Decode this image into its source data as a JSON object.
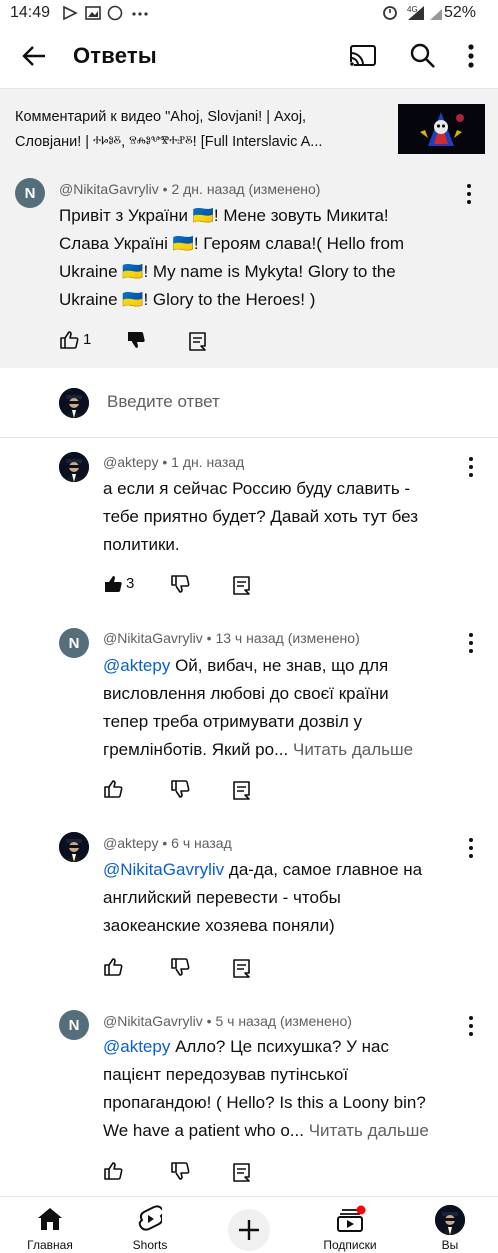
{
  "status_bar": {
    "time": "14:49",
    "battery": "52%",
    "network": "4G"
  },
  "app_bar": {
    "title": "Ответы"
  },
  "video": {
    "title": "Комментарий к видео \"Ahoj, Slovjani! | Ахој,\nСловјани! | ⰰⱈⱁⰻ, ⱄⰾⱁⰲⰺⰰⱀⰻ! [Full Interslavic A..."
  },
  "original_comment": {
    "avatar_letter": "N",
    "meta": "@NikitaGavryliv • 2 дн. назад (изменено)",
    "lines": [
      "Привіт з України 🇺🇦! Мене зовуть Микита!",
      "Слава Україні 🇺🇦! Героям слава!( Hello from",
      "Ukraine 🇺🇦! My name is Mykyta! Glory to the",
      "Ukraine 🇺🇦! Glory to the Heroes! )"
    ],
    "likes": "1"
  },
  "reply_input": {
    "placeholder": "Введите ответ"
  },
  "replies": [
    {
      "meta": "@aktepy • 1 дн. назад",
      "lines": [
        "а если я сейчас Россию буду славить -",
        "тебе приятно будет? Давай хоть тут без",
        "политики."
      ],
      "likes": "3"
    },
    {
      "avatar_letter": "N",
      "meta": "@NikitaGavryliv • 13 ч назад (изменено)",
      "mention": "@aktepy",
      "line1_rest": " Ой, вибач, не знав, що для",
      "lines": [
        "висловлення любові до своєї країни",
        "тепер треба отримувати дозвіл у"
      ],
      "last_line": "гремлінботів. Який ро...",
      "read_more": "Читать дальше"
    },
    {
      "meta": "@aktepy • 6 ч назад",
      "mention": "@NikitaGavryliv",
      "line1_rest": "  да-да, самое главное на",
      "lines": [
        "английский перевести - чтобы",
        "заокеанские хозяева поняли)"
      ]
    },
    {
      "avatar_letter": "N",
      "meta": "@NikitaGavryliv • 5 ч назад (изменено)",
      "mention": "@aktepy",
      "line1_rest": "  Алло? Це психушка? У нас",
      "lines": [
        "пацієнт передозував путінської",
        "пропагандою! ( Hello? Is this a Loony bin?"
      ],
      "last_line": "We have a patient who o...",
      "read_more": "Читать дальше"
    }
  ],
  "bottom_nav": {
    "home": "Главная",
    "shorts": "Shorts",
    "subscriptions": "Подписки",
    "you": "Вы"
  },
  "colors": {
    "link": "#065fd4",
    "meta": "#606060",
    "highlight_bg": "#f2f2f2"
  }
}
